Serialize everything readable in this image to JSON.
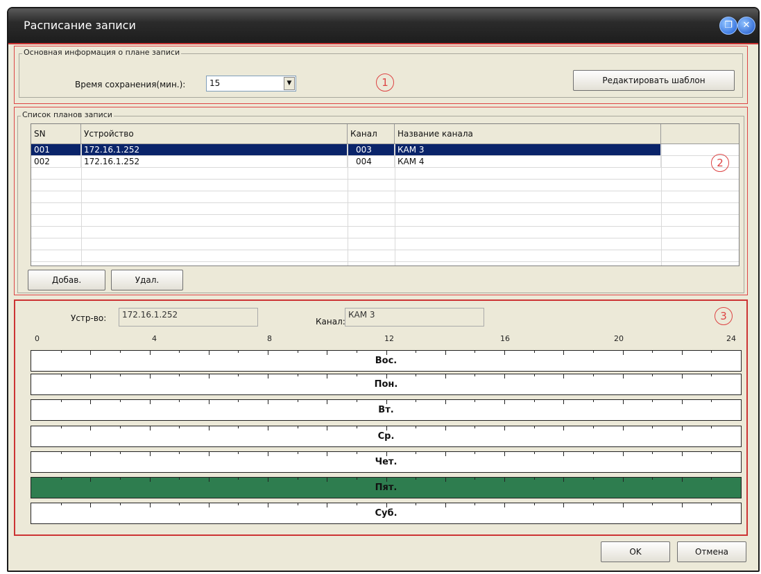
{
  "window": {
    "title": "Расписание записи"
  },
  "section1": {
    "legend": "Основная информация о плане записи",
    "retention_label": "Время сохранения(мин.):",
    "retention_value": "15",
    "edit_template_label": "Редактировать шаблон",
    "marker": "1"
  },
  "section2": {
    "legend": "Список планов записи",
    "marker": "2",
    "columns": [
      "SN",
      "Устройство",
      "Канал",
      "Название канала"
    ],
    "rows": [
      {
        "sn": "001",
        "device": "172.16.1.252",
        "channel": "003",
        "name": "КАМ 3",
        "selected": true
      },
      {
        "sn": "002",
        "device": "172.16.1.252",
        "channel": "004",
        "name": "КАМ 4",
        "selected": false
      }
    ],
    "add_label": "Добав.",
    "delete_label": "Удал."
  },
  "section3": {
    "marker": "3",
    "device_label": "Устр-во:",
    "device_value": "172.16.1.252",
    "channel_label": "Канал:",
    "channel_value": "КАМ 3",
    "hour_ticks": [
      "0",
      "4",
      "8",
      "12",
      "16",
      "20",
      "24"
    ],
    "days": [
      {
        "label": "Вос.",
        "active": false
      },
      {
        "label": "Пон.",
        "active": false
      },
      {
        "label": "Вт.",
        "active": false
      },
      {
        "label": "Ср.",
        "active": false
      },
      {
        "label": "Чет.",
        "active": false
      },
      {
        "label": "Пят.",
        "active": true
      },
      {
        "label": "Суб.",
        "active": false
      }
    ],
    "active_color": "#2e7d4f"
  },
  "footer": {
    "ok_label": "OK",
    "cancel_label": "Отмена"
  },
  "icons": {
    "restore": "restore-icon",
    "close": "close-icon",
    "dropdown": "chevron-down-icon"
  }
}
